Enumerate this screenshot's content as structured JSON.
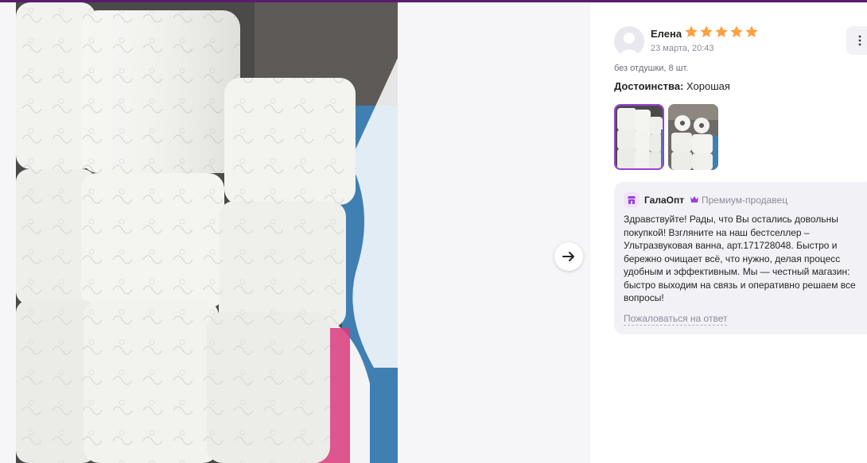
{
  "review": {
    "author": "Елена",
    "rating": 5,
    "date": "23 марта, 20:43",
    "variant": "без отдушки, 8 шт.",
    "merits_label": "Достоинства:",
    "merits_text": "Хорошая",
    "thumbnails_count": 2
  },
  "seller_reply": {
    "shop_name": "ГалаОпт",
    "badge": "Премиум-продавец",
    "text": "Здравствуйте! Рады, что Вы остались довольны покупкой! Взгляните на наш бестселлер – Ультразвуковая ванна, арт.171728048. Быстро и бережно очищает всё, что нужно, делая процесс удобным и эффективным. Мы — честный магазин: быстро выходим на связь и оперативно решаем все вопросы!",
    "report_link": "Пожаловаться на ответ"
  },
  "colors": {
    "accent": "#9b3fd8",
    "star": "#ff9f3f",
    "top_strip": "#5b1b6e"
  },
  "icons": [
    "arrow-right-icon",
    "star-icon",
    "more-vertical-icon",
    "shop-icon",
    "crown-icon",
    "user-avatar-icon"
  ]
}
